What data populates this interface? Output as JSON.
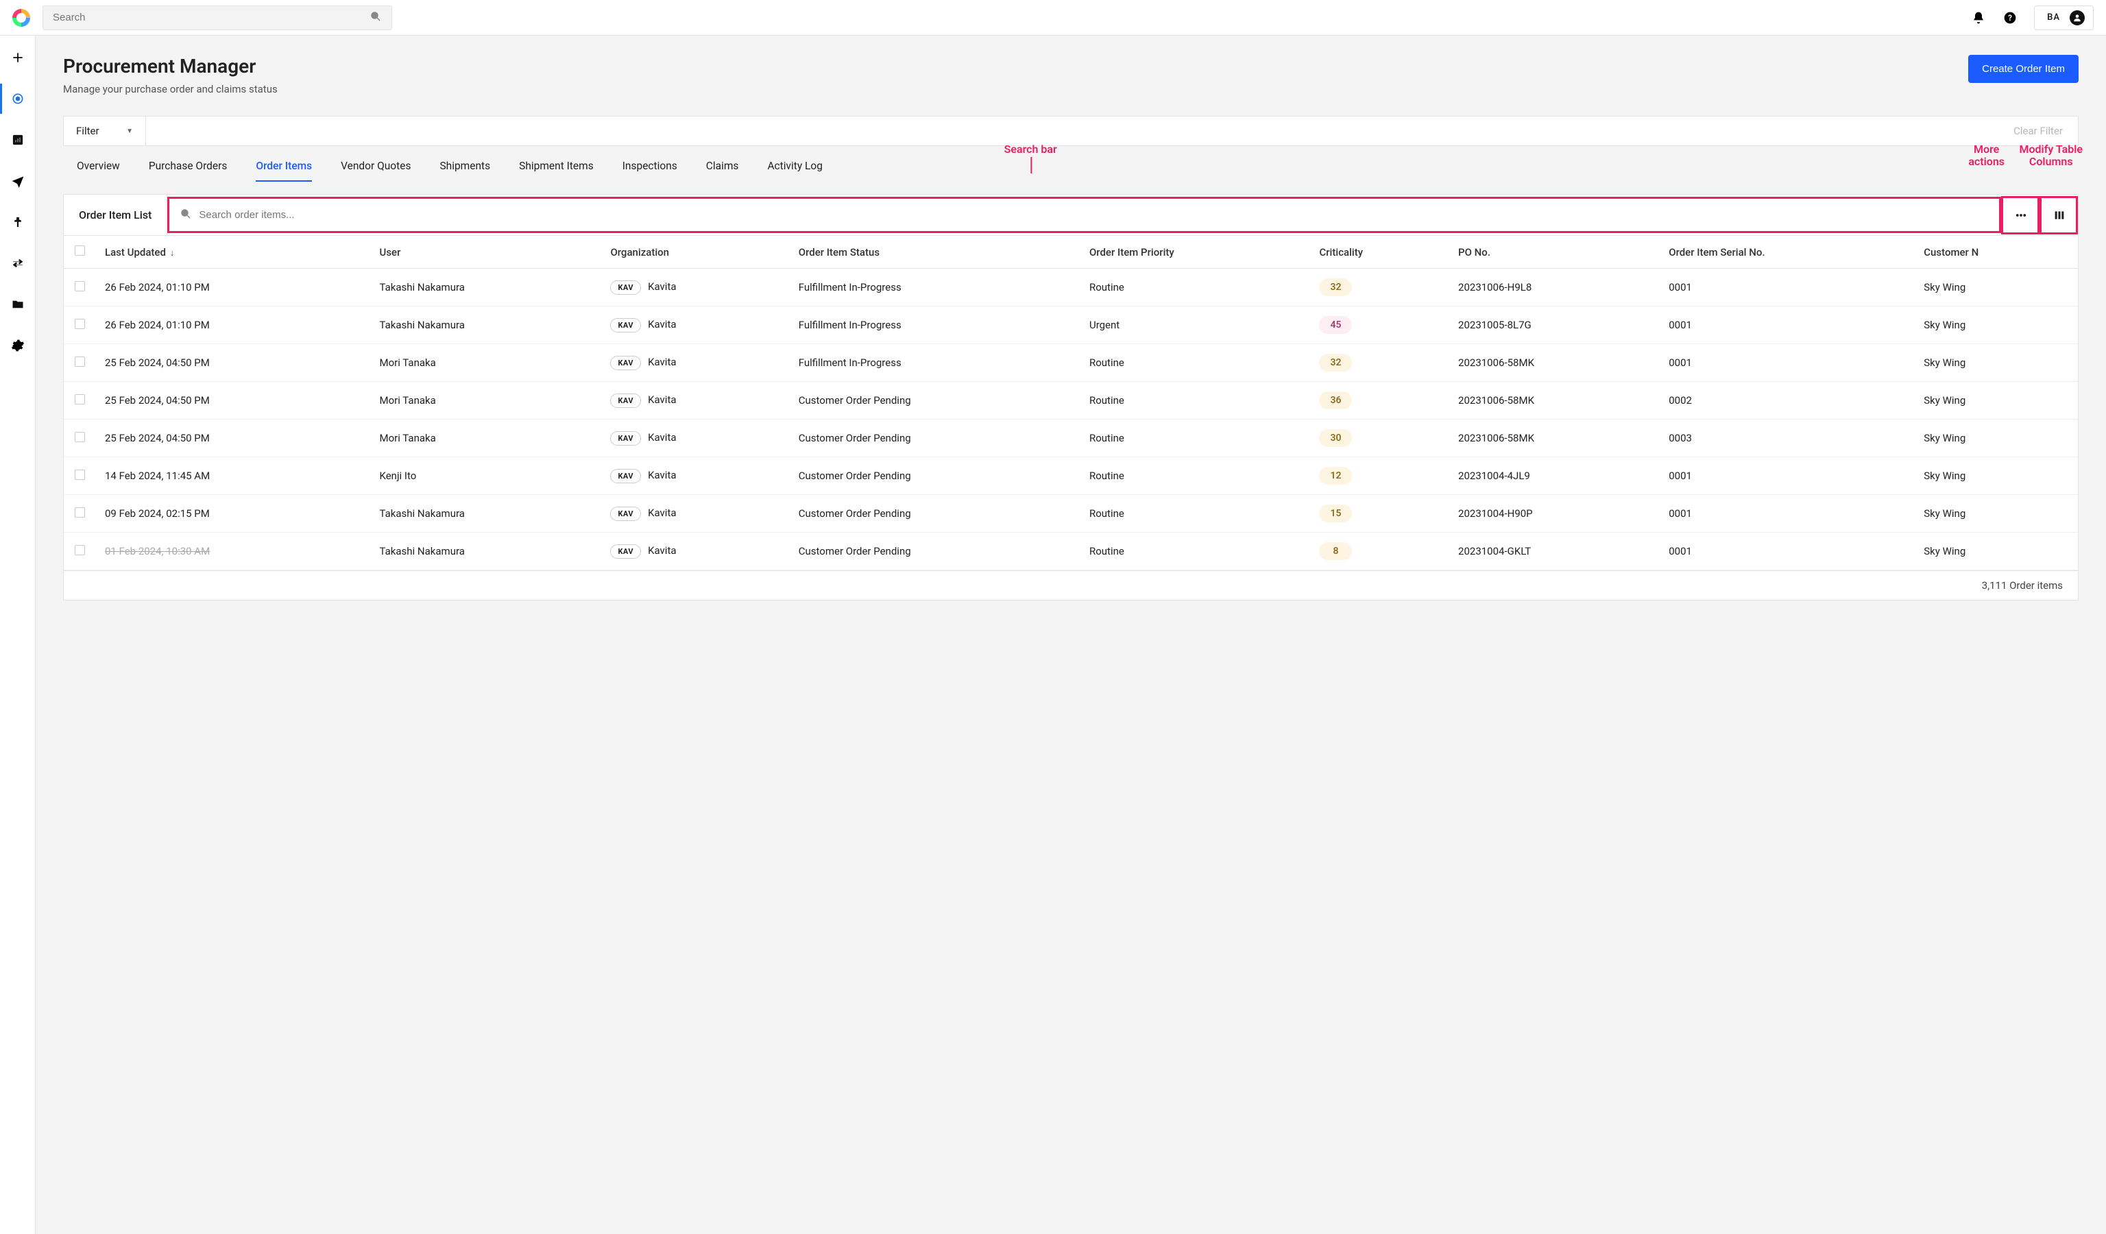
{
  "topbar": {
    "search_placeholder": "Search",
    "user_initials": "BA"
  },
  "page": {
    "title": "Procurement Manager",
    "subtitle": "Manage your purchase order and claims status",
    "create_button": "Create Order Item",
    "filter_label": "Filter",
    "clear_filter": "Clear Filter"
  },
  "tabs": [
    "Overview",
    "Purchase Orders",
    "Order Items",
    "Vendor Quotes",
    "Shipments",
    "Shipment Items",
    "Inspections",
    "Claims",
    "Activity Log"
  ],
  "active_tab": "Order Items",
  "card": {
    "title": "Order Item List",
    "search_placeholder": "Search order items..."
  },
  "annotations": {
    "search_bar": "Search bar",
    "more_actions_l1": "More",
    "more_actions_l2": "actions",
    "modify_cols_l1": "Modify Table",
    "modify_cols_l2": "Columns"
  },
  "columns": [
    "",
    "Last Updated",
    "User",
    "Organization",
    "Order Item Status",
    "Order Item Priority",
    "Criticality",
    "PO No.",
    "Order Item Serial No.",
    "Customer N"
  ],
  "rows": [
    {
      "last": "26 Feb 2024, 01:10 PM",
      "user": "Takashi Nakamura",
      "org_code": "KAV",
      "org_name": "Kavita",
      "status": "Fulfillment In-Progress",
      "priority": "Routine",
      "crit": "32",
      "crit_cls": "low",
      "po": "20231006-H9L8",
      "serial": "0001",
      "cust": "Sky Wing"
    },
    {
      "last": "26 Feb 2024, 01:10 PM",
      "user": "Takashi Nakamura",
      "org_code": "KAV",
      "org_name": "Kavita",
      "status": "Fulfillment In-Progress",
      "priority": "Urgent",
      "crit": "45",
      "crit_cls": "mid",
      "po": "20231005-8L7G",
      "serial": "0001",
      "cust": "Sky Wing"
    },
    {
      "last": "25 Feb 2024, 04:50 PM",
      "user": "Mori Tanaka",
      "org_code": "KAV",
      "org_name": "Kavita",
      "status": "Fulfillment In-Progress",
      "priority": "Routine",
      "crit": "32",
      "crit_cls": "low",
      "po": "20231006-58MK",
      "serial": "0001",
      "cust": "Sky Wing"
    },
    {
      "last": "25 Feb 2024, 04:50 PM",
      "user": "Mori Tanaka",
      "org_code": "KAV",
      "org_name": "Kavita",
      "status": "Customer Order Pending",
      "priority": "Routine",
      "crit": "36",
      "crit_cls": "low",
      "po": "20231006-58MK",
      "serial": "0002",
      "cust": "Sky Wing"
    },
    {
      "last": "25 Feb 2024, 04:50 PM",
      "user": "Mori Tanaka",
      "org_code": "KAV",
      "org_name": "Kavita",
      "status": "Customer Order Pending",
      "priority": "Routine",
      "crit": "30",
      "crit_cls": "low",
      "po": "20231006-58MK",
      "serial": "0003",
      "cust": "Sky Wing"
    },
    {
      "last": "14 Feb 2024, 11:45 AM",
      "user": "Kenji Ito",
      "org_code": "KAV",
      "org_name": "Kavita",
      "status": "Customer Order Pending",
      "priority": "Routine",
      "crit": "12",
      "crit_cls": "low",
      "po": "20231004-4JL9",
      "serial": "0001",
      "cust": "Sky Wing"
    },
    {
      "last": "09 Feb 2024, 02:15 PM",
      "user": "Takashi Nakamura",
      "org_code": "KAV",
      "org_name": "Kavita",
      "status": "Customer Order Pending",
      "priority": "Routine",
      "crit": "15",
      "crit_cls": "low",
      "po": "20231004-H90P",
      "serial": "0001",
      "cust": "Sky Wing"
    },
    {
      "last": "01 Feb 2024, 10:30 AM",
      "strike": true,
      "user": "Takashi Nakamura",
      "org_code": "KAV",
      "org_name": "Kavita",
      "status": "Customer Order Pending",
      "priority": "Routine",
      "crit": "8",
      "crit_cls": "low",
      "po": "20231004-GKLT",
      "serial": "0001",
      "cust": "Sky Wing"
    }
  ],
  "footer_count": "3,111 Order items"
}
